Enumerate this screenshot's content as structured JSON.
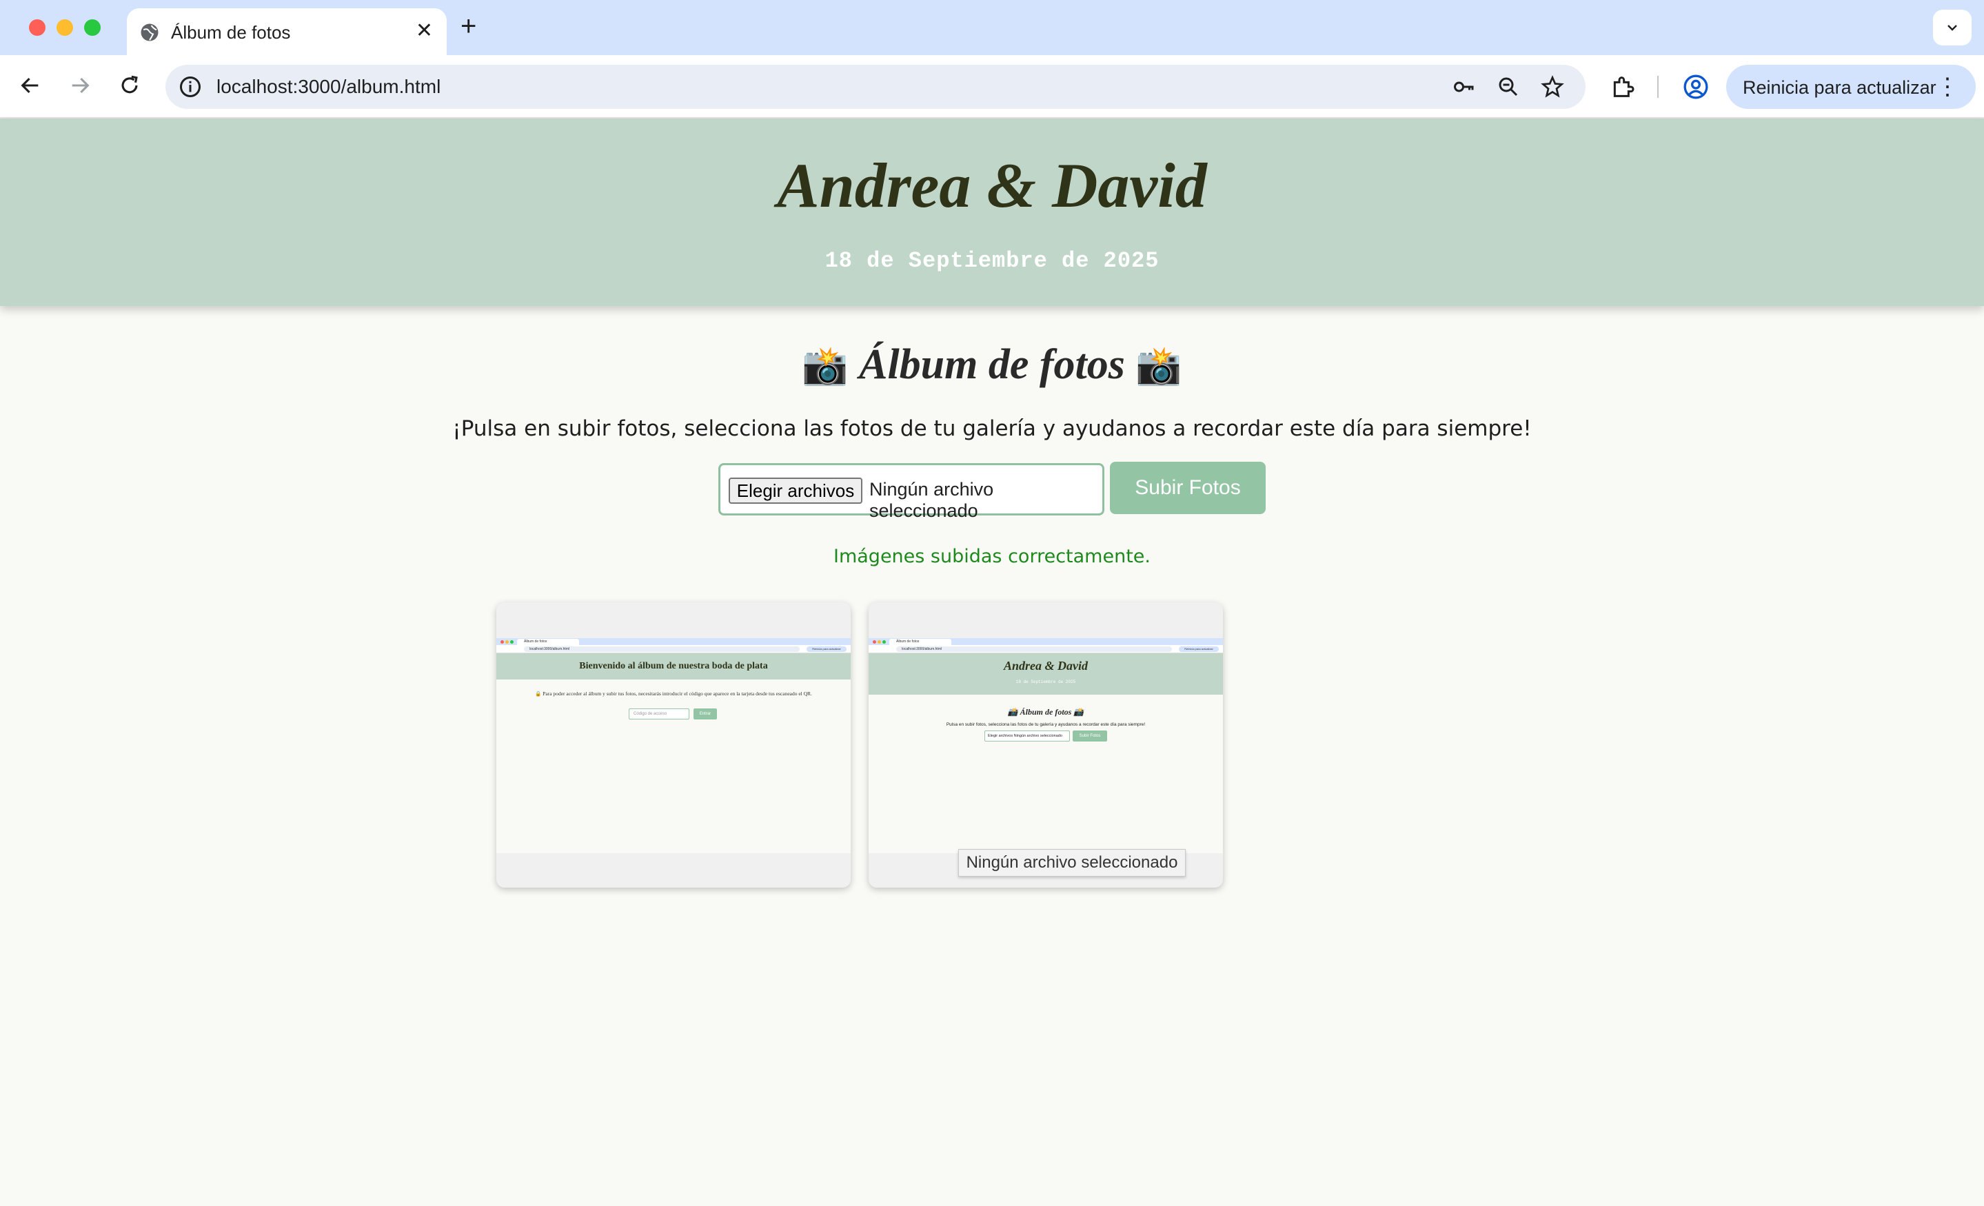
{
  "browser": {
    "tab_title": "Álbum de fotos",
    "url": "localhost:3000/album.html",
    "update_label": "Reinicia para actualizar"
  },
  "header": {
    "couple": "Andrea & David",
    "date": "18 de Septiembre de 2025"
  },
  "album": {
    "title": "Álbum de fotos",
    "title_emoji": "📸",
    "instructions": "¡Pulsa en subir fotos, selecciona las fotos de tu galería y ayudanos a recordar este día para siempre!",
    "choose_label": "Elegir archivos",
    "no_file_label": "Ningún archivo seleccionado",
    "upload_label": "Subir Fotos",
    "success_message": "Imágenes subidas correctamente."
  },
  "photos": [
    {
      "header": "Bienvenido al álbum de nuestra boda de plata",
      "text": "🔒 Para poder acceder al álbum y subir tus fotos, necesitarás introducir el código que aparece en la tarjeta desde tus escaneado el QR.",
      "input_placeholder": "Código de acceso",
      "button": "Entrar"
    },
    {
      "couple": "Andrea & David",
      "date": "18 de Septiembre de 2025",
      "title": "📸 Álbum de fotos 📸",
      "text": "Pulsa en subir fotos, selecciona las fotos de tu galería y ayudanos a recordar este día para siempre!",
      "file_text": "Elegir archivos Ningún archivo seleccionado",
      "upload": "Subir Fotos"
    }
  ],
  "tooltip": "Ningún archivo seleccionado",
  "colors": {
    "banner": "#bfd6c8",
    "accent_green": "#93c5a5",
    "success": "#1e8a1e",
    "title_dark": "#2f3318"
  }
}
